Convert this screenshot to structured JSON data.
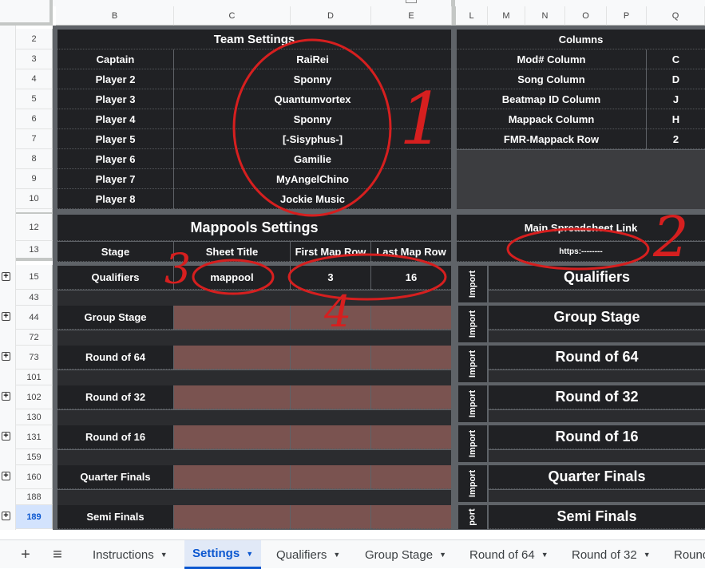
{
  "columns": {
    "B": "B",
    "C": "C",
    "D": "D",
    "E": "E",
    "L": "L",
    "M": "M",
    "N": "N",
    "O": "O",
    "P": "P",
    "Q": "Q"
  },
  "rows": {
    "r2": "2",
    "r3": "3",
    "r4": "4",
    "r5": "5",
    "r6": "6",
    "r7": "7",
    "r8": "8",
    "r9": "9",
    "r10": "10",
    "r12": "12",
    "r13": "13",
    "r15": "15",
    "r43": "43",
    "r44": "44",
    "r72": "72",
    "r73": "73",
    "r101": "101",
    "r102": "102",
    "r130": "130",
    "r131": "131",
    "r159": "159",
    "r160": "160",
    "r188": "188",
    "r189": "189"
  },
  "team": {
    "title": "Team Settings",
    "players": [
      {
        "role": "Captain",
        "name": "RaiRei"
      },
      {
        "role": "Player 2",
        "name": "Sponny"
      },
      {
        "role": "Player 3",
        "name": "Quantumvortex"
      },
      {
        "role": "Player 4",
        "name": "Sponny"
      },
      {
        "role": "Player 5",
        "name": "[-Sisyphus-]"
      },
      {
        "role": "Player 6",
        "name": "Gamilie"
      },
      {
        "role": "Player 7",
        "name": "MyAngelChino"
      },
      {
        "role": "Player 8",
        "name": "Jockie Music"
      }
    ]
  },
  "columns_settings": {
    "title": "Columns",
    "items": [
      {
        "label": "Mod# Column",
        "value": "C"
      },
      {
        "label": "Song Column",
        "value": "D"
      },
      {
        "label": "Beatmap ID Column",
        "value": "J"
      },
      {
        "label": "Mappack Column",
        "value": "H"
      },
      {
        "label": "FMR-Mappack Row",
        "value": "2"
      }
    ]
  },
  "mappools": {
    "title": "Mappools Settings",
    "headers": {
      "stage": "Stage",
      "sheet_title": "Sheet Title",
      "first_row": "First Map Row",
      "last_row": "Last Map Row"
    },
    "qualifiers": {
      "stage": "Qualifiers",
      "sheet_title": "mappool",
      "first_row": "3",
      "last_row": "16"
    },
    "stages": [
      "Group Stage",
      "Round of 64",
      "Round of 32",
      "Round of 16",
      "Quarter Finals",
      "Semi Finals"
    ]
  },
  "link": {
    "title": "Main Spreadsheet Link",
    "value": "https:--------"
  },
  "import": {
    "label": "Import",
    "truncated_label": "port",
    "stages": [
      "Qualifiers",
      "Group Stage",
      "Round of 64",
      "Round of 32",
      "Round of 16",
      "Quarter Finals",
      "Semi Finals"
    ]
  },
  "annotations": {
    "n1": "1",
    "n2": "2",
    "n3": "3",
    "n4": "4",
    "color": "#d61f1f"
  },
  "tabs": {
    "items": [
      "Instructions",
      "Settings",
      "Qualifiers",
      "Group Stage",
      "Round of 64",
      "Round of 32",
      "Round"
    ],
    "active": "Settings"
  },
  "icons": {
    "add": "+",
    "menu": "≡",
    "expand": "+",
    "caret": "▼"
  }
}
